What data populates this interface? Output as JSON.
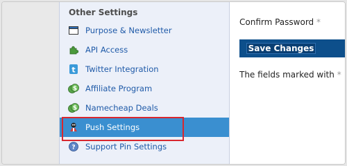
{
  "sidebar": {
    "header": "Other Settings",
    "items": [
      {
        "label": "Purpose & Newsletter",
        "icon": "window-icon"
      },
      {
        "label": "API Access",
        "icon": "puzzle-icon"
      },
      {
        "label": "Twitter Integration",
        "icon": "twitter-icon"
      },
      {
        "label": "Affiliate Program",
        "icon": "dollar-icon"
      },
      {
        "label": "Namecheap Deals",
        "icon": "dollar-icon"
      },
      {
        "label": "Push Settings",
        "icon": "push-icon",
        "active": true
      },
      {
        "label": "Support Pin Settings",
        "icon": "help-icon"
      }
    ]
  },
  "main": {
    "confirm_label": "Confirm Password",
    "required_mark": "*",
    "save_label": "Save Changes",
    "required_note": "The fields marked with",
    "required_note_mark": "*"
  },
  "colors": {
    "accent": "#3a8fd0",
    "link": "#1f5aa8",
    "save_bar": "#0d4f8b",
    "highlight": "#d8262e"
  }
}
